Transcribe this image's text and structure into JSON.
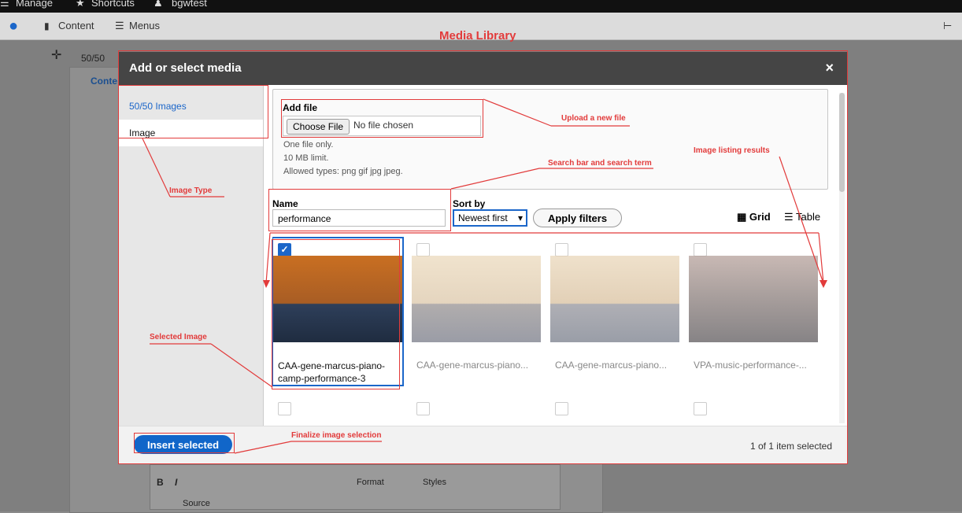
{
  "topbar": {
    "manage": "Manage",
    "shortcuts": "Shortcuts",
    "user": "bgwtest"
  },
  "toolbar": {
    "content": "Content",
    "menus": "Menus"
  },
  "background": {
    "row_label": "50/50",
    "content_tab": "Conte",
    "editor_label": "Format",
    "styles_label": "Styles",
    "source_label": "Source"
  },
  "overlay": {
    "title": "Media Library"
  },
  "modal": {
    "title": "Add or select media",
    "close": "×",
    "left_items": [
      "50/50 Images",
      "Image"
    ],
    "upload": {
      "title": "Add file",
      "choose_btn": "Choose File",
      "file_text": "No file chosen",
      "rules": [
        "One file only.",
        "10 MB limit.",
        "Allowed types: png gif jpg jpeg."
      ]
    },
    "filters": {
      "name_label": "Name",
      "name_value": "performance",
      "sort_label": "Sort by",
      "sort_value": "Newest first",
      "apply": "Apply filters",
      "grid": "Grid",
      "table": "Table"
    },
    "cards": [
      {
        "caption": "CAA-gene-marcus-piano-camp-performance-3",
        "checked": true
      },
      {
        "caption": "CAA-gene-marcus-piano...",
        "checked": false
      },
      {
        "caption": "CAA-gene-marcus-piano...",
        "checked": false
      },
      {
        "caption": "VPA-music-performance-...",
        "checked": false
      }
    ],
    "footer": {
      "insert": "Insert selected",
      "selected": "1 of 1 item selected"
    }
  },
  "annotations": {
    "upload": "Upload a new file",
    "image_listing": "Image listing results",
    "search": "Search bar and search term",
    "image_type": "Image Type",
    "selected": "Selected Image",
    "finalize": "Finalize image selection"
  },
  "colors": {
    "accent": "#1b66c9",
    "annotation": "#e23b3b",
    "header": "#454545"
  }
}
